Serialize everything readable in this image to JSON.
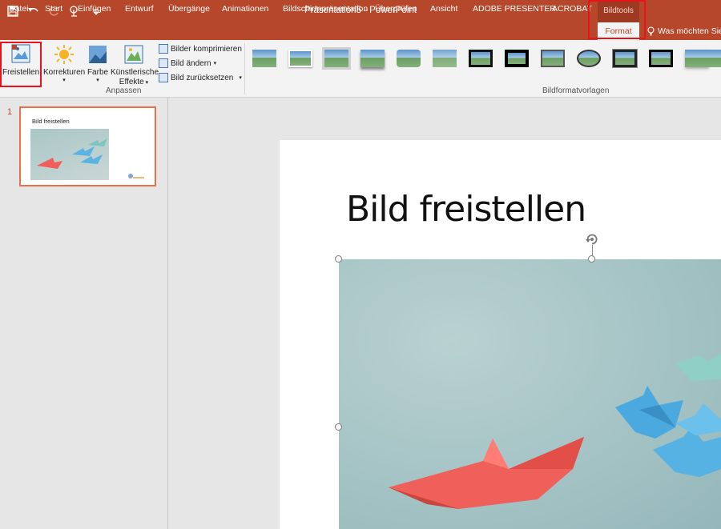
{
  "app": {
    "title": "Präsentation5 - PowerPoint",
    "context_group": "Bildtools"
  },
  "qat": {
    "icons": [
      "save-icon",
      "undo-icon",
      "redo-icon",
      "touch-mode-icon",
      "customize-icon"
    ]
  },
  "tabs": [
    "Datei",
    "Start",
    "Einfügen",
    "Entwurf",
    "Übergänge",
    "Animationen",
    "Bildschirmpräsentation",
    "Überprüfen",
    "Ansicht",
    "ADOBE PRESENTER",
    "ACROBAT"
  ],
  "active_tab": "Format",
  "tell_me": "Was möchten Sie tu",
  "ribbon": {
    "freistellen": "Freistellen",
    "korrekturen": "Korrekturen",
    "farbe": "Farbe",
    "kuenstlerisch_1": "Künstlerische",
    "kuenstlerisch_2": "Effekte",
    "komprimieren": "Bilder komprimieren",
    "aendern": "Bild ändern",
    "zuruecksetzen": "Bild zurücksetzen",
    "group_anpassen": "Anpassen",
    "group_vorlagen": "Bildformatvorlagen",
    "style_count": 13
  },
  "thumbnails": {
    "number": "1",
    "title": "Bild freistellen"
  },
  "slide": {
    "title": "Bild freistellen"
  },
  "colors": {
    "accent": "#b7472a",
    "highlight": "#e8131b",
    "boat_red": "#f0605a",
    "boat_blue": "#5ab3e0"
  }
}
